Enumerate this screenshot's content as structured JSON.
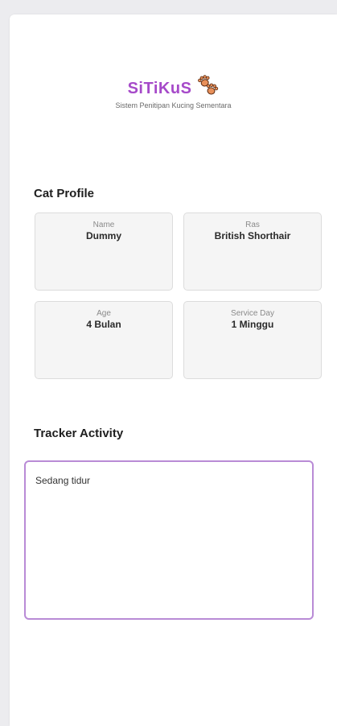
{
  "brand": {
    "title": "SiTiKuS",
    "subtitle": "Sistem Penitipan Kucing Sementara",
    "title_color": "#a64ac9"
  },
  "cat_profile": {
    "heading": "Cat Profile",
    "cards": [
      {
        "label": "Name",
        "value": "Dummy"
      },
      {
        "label": "Ras",
        "value": "British Shorthair"
      },
      {
        "label": "Age",
        "value": "4 Bulan"
      },
      {
        "label": "Service Day",
        "value": "1 Minggu"
      }
    ]
  },
  "tracker": {
    "heading": "Tracker Activity",
    "value": "Sedang tidur",
    "border_color": "#b98bd6"
  },
  "icons": {
    "brand_icon": "paw-icon"
  }
}
